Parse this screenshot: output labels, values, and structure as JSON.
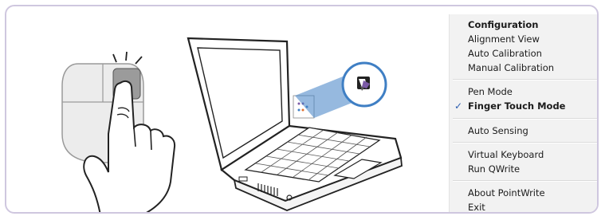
{
  "context_menu": {
    "items": [
      {
        "label": "Configuration",
        "bold": true,
        "checked": false
      },
      {
        "label": "Alignment View",
        "bold": false,
        "checked": false
      },
      {
        "label": "Auto Calibration",
        "bold": false,
        "checked": false
      },
      {
        "label": "Manual Calibration",
        "bold": false,
        "checked": false
      },
      {
        "label": "Pen Mode",
        "bold": false,
        "checked": false
      },
      {
        "label": "Finger Touch Mode",
        "bold": true,
        "checked": true
      },
      {
        "label": "Auto Sensing",
        "bold": false,
        "checked": false
      },
      {
        "label": "Virtual Keyboard",
        "bold": false,
        "checked": false
      },
      {
        "label": "Run QWrite",
        "bold": false,
        "checked": false
      },
      {
        "label": "About PointWrite",
        "bold": false,
        "checked": false
      },
      {
        "label": "Exit",
        "bold": false,
        "checked": false
      }
    ],
    "check_mark": "✓"
  },
  "icons": {
    "tray_icon": "pointwrite-tray-icon",
    "mouse": "mouse-icon",
    "hand": "pointing-finger-icon",
    "laptop": "laptop-icon"
  },
  "colors": {
    "frame_border": "#cfc7df",
    "menu_bg": "#f2f2f2",
    "check": "#2b5db0",
    "callout_blue": "#3f7fc4"
  }
}
